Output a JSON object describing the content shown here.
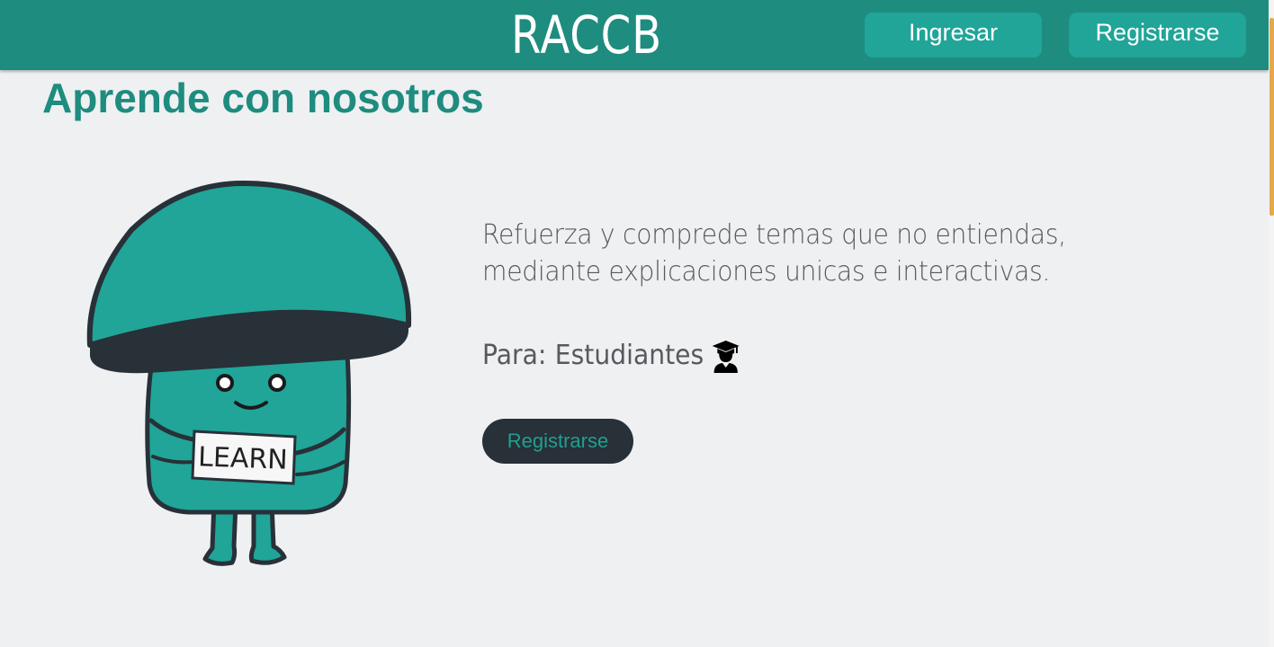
{
  "header": {
    "brand": "RACCB",
    "login_label": "Ingresar",
    "register_label": "Registrarse"
  },
  "main": {
    "title": "Aprende con nosotros",
    "description_line1": "Refuerza y comprede temas que no entiendas,",
    "description_line2": "mediante explicaciones unicas e interactivas.",
    "audience_prefix": "Para:",
    "audience_value": "Estudiantes",
    "cta_label": "Registrarse",
    "mascot_sign": "LEARN"
  },
  "icons": {
    "audience": "student-graduate-icon"
  },
  "colors": {
    "header": "#1e8c7f",
    "header_button": "#20a598",
    "title": "#1e8c7f",
    "cta_background": "#283038",
    "cta_text": "#1fa090",
    "background": "#eef0f2",
    "mascot_body": "#20a598",
    "mascot_outline": "#283038"
  }
}
